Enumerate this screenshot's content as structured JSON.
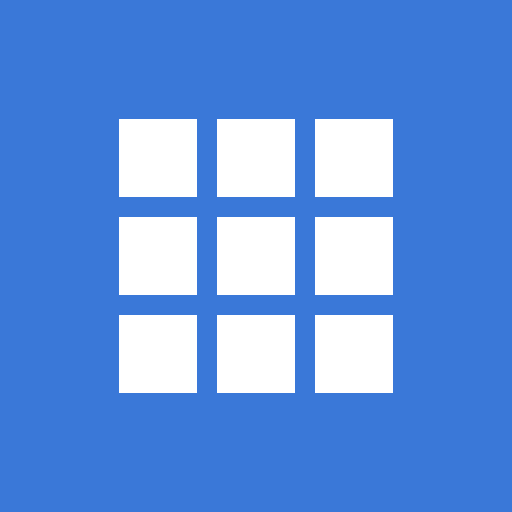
{
  "app_icon": {
    "icon": "grid-3x3-icon",
    "colors": {
      "background": "#3A78D8",
      "tile": "#FFFFFF"
    },
    "rows": 3,
    "columns": 3
  }
}
